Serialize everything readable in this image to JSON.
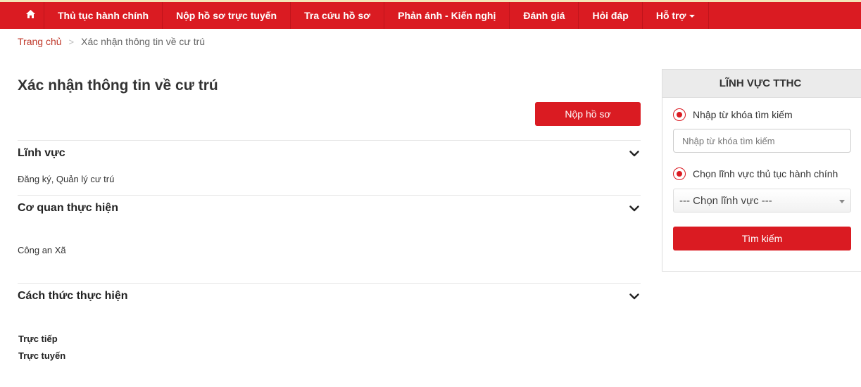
{
  "nav": {
    "home_icon": "home-icon",
    "items": [
      {
        "label": "Thủ tục hành chính"
      },
      {
        "label": "Nộp hồ sơ trực tuyến"
      },
      {
        "label": "Tra cứu hồ sơ"
      },
      {
        "label": "Phản ánh - Kiến nghị"
      },
      {
        "label": "Đánh giá"
      },
      {
        "label": "Hỏi đáp"
      },
      {
        "label": "Hỗ trợ"
      }
    ],
    "accent_color": "#da1b22"
  },
  "breadcrumb": {
    "home": "Trang chủ",
    "separator": ">",
    "current": "Xác nhận thông tin về cư trú"
  },
  "main": {
    "title": "Xác nhận thông tin về cư trú",
    "submit_label": "Nộp hồ sơ",
    "sections": [
      {
        "title": "Lĩnh vực",
        "content": [
          "Đăng ký, Quản lý cư trú"
        ]
      },
      {
        "title": "Cơ quan thực hiện",
        "content": [
          "Công an Xã"
        ]
      },
      {
        "title": "Cách thức thực hiện",
        "content": [
          "Trực tiếp",
          "Trực tuyến"
        ]
      }
    ]
  },
  "sidebar": {
    "title": "LĨNH VỰC TTHC",
    "keyword_label": "Nhập từ khóa tìm kiếm",
    "keyword_placeholder": "Nhập từ khóa tìm kiếm",
    "field_label": "Chọn lĩnh vực thủ tục hành chính",
    "field_select_value": "--- Chọn lĩnh vực ---",
    "search_label": "Tìm kiếm"
  }
}
